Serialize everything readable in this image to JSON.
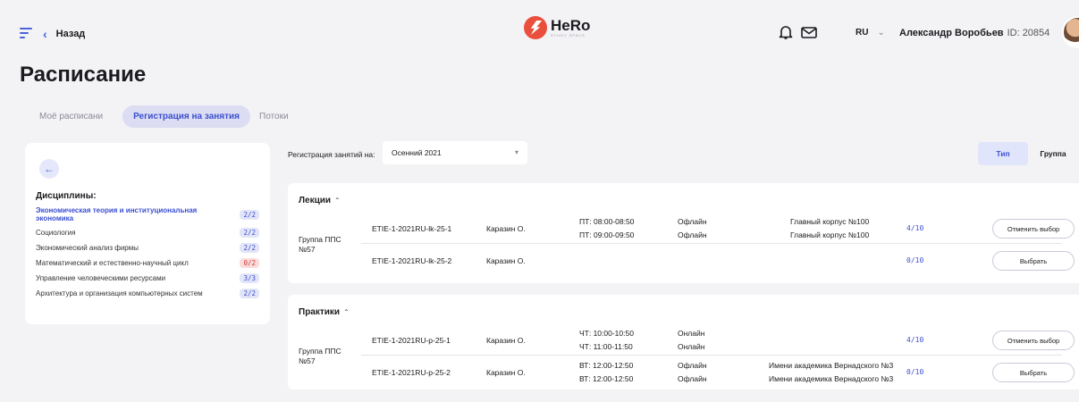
{
  "topbar": {
    "back_label": "Назад",
    "logo_name": "HeRo",
    "logo_sub": "STUDY SPACE",
    "lang": "RU",
    "user_name": "Александр Воробьев",
    "user_id": "ID: 20854"
  },
  "page_title": "Расписание",
  "tabs": [
    {
      "label": "Моё расписани"
    },
    {
      "label": "Регистрация на занятия"
    },
    {
      "label": "Потоки"
    }
  ],
  "sidebar": {
    "title": "Дисциплины:",
    "items": [
      {
        "label": "Экономическая теория и институциональная экономика",
        "count": "2/2"
      },
      {
        "label": "Социология",
        "count": "2/2"
      },
      {
        "label": "Экономический анализ фирмы",
        "count": "2/2"
      },
      {
        "label": "Математический и естественно-научный цикл",
        "count": "0/2"
      },
      {
        "label": "Управление человеческими ресурсами",
        "count": "3/3"
      },
      {
        "label": "Архитектура и организация компьютерных систем",
        "count": "2/2"
      }
    ]
  },
  "registration": {
    "label": "Регистрация занятий на:",
    "selected": "Осенний 2021"
  },
  "view_toggle": {
    "type": "Тип",
    "group": "Группа"
  },
  "lectures": {
    "title": "Лекции",
    "group": "Группа ППС №57",
    "rows": [
      {
        "code": "ETIE-1-2021RU-lk-25-1",
        "teacher": "Каразин О.",
        "time1": "ПТ: 08:00-08:50",
        "time2": "ПТ: 09:00-09:50",
        "mode1": "Офлайн",
        "mode2": "Офлайн",
        "place1": "Главный корпус №100",
        "place2": "Главный корпус №100",
        "cap": "4/10",
        "btn": "Отменить выбор"
      },
      {
        "code": "ETIE-1-2021RU-lk-25-2",
        "teacher": "Каразин О.",
        "cap": "0/10",
        "btn": "Выбрать"
      }
    ]
  },
  "practices": {
    "title": "Практики",
    "group": "Группа ППС №57",
    "rows": [
      {
        "code": "ETIE-1-2021RU-p-25-1",
        "teacher": "Каразин О.",
        "time1": "ЧТ: 10:00-10:50",
        "time2": "ЧТ: 11:00-11:50",
        "mode1": "Онлайн",
        "mode2": "Онлайн",
        "cap": "4/10",
        "btn": "Отменить выбор"
      },
      {
        "code": "ETIE-1-2021RU-p-25-2",
        "teacher": "Каразин О.",
        "time1": "ВТ: 12:00-12:50",
        "time2": "ВТ: 12:00-12:50",
        "mode1": "Офлайн",
        "mode2": "Офлайн",
        "place1": "Имени академика Вернадского №3",
        "place2": "Имени академика Вернадского №3",
        "cap": "0/10",
        "btn": "Выбрать"
      }
    ]
  },
  "colors": {
    "accent": "#3b4fd0",
    "brand": "#e94f3c",
    "danger": "#d23b3b"
  }
}
